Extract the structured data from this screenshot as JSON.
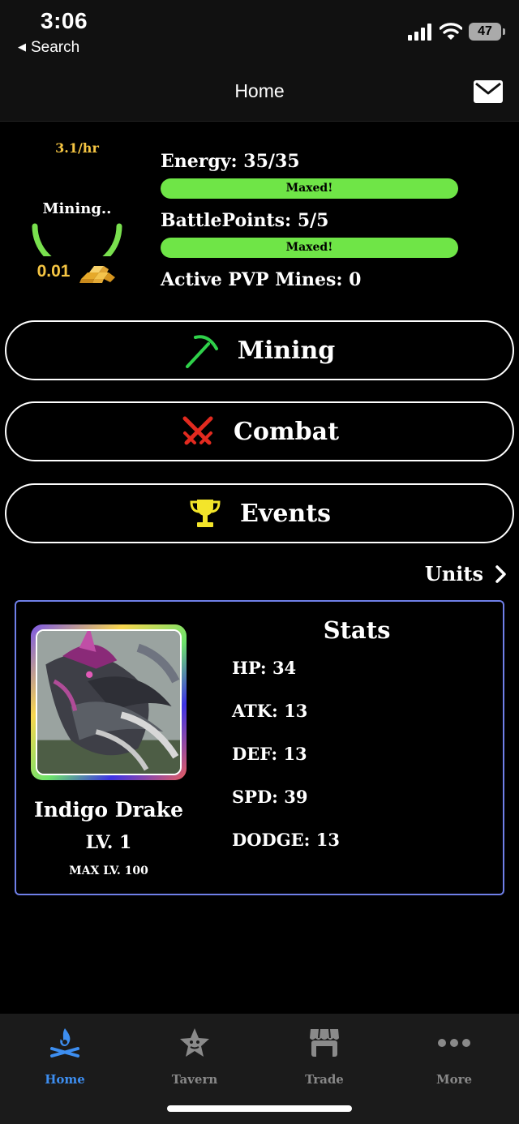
{
  "status_bar": {
    "time": "3:06",
    "back_label": "Search",
    "battery": "47"
  },
  "nav": {
    "title": "Home",
    "mail_icon": "mail-icon"
  },
  "mining": {
    "rate": "3.1/hr",
    "label": "Mining..",
    "gold_amount": "0.01",
    "gold_icon": "gold-bars-icon"
  },
  "stats": {
    "energy": "Energy: 35/35",
    "energy_bar_label": "Maxed!",
    "energy_level": 1.0,
    "battle_points": "BattlePoints: 5/5",
    "battle_bar_label": "Maxed!",
    "battle_level": 1.0,
    "active_pvp": "Active PVP Mines:  0"
  },
  "menu": {
    "mining": {
      "label": "Mining",
      "icon": "pickaxe-icon",
      "color": "#2fd14a"
    },
    "combat": {
      "label": "Combat",
      "icon": "crossed-swords-icon",
      "color": "#e22a1f"
    },
    "events": {
      "label": "Events",
      "icon": "trophy-icon",
      "color": "#f3e52a"
    }
  },
  "units_link": "Units",
  "unit": {
    "name": "Indigo Drake",
    "level": "LV. 1",
    "max_level": "MAX LV. 100",
    "stats_title": "Stats",
    "stats": [
      "HP: 34",
      "ATK: 13",
      "DEF: 13",
      "SPD: 39",
      "DODGE: 13"
    ]
  },
  "tabs": [
    {
      "label": "Home",
      "icon": "campfire-icon",
      "active": true
    },
    {
      "label": "Tavern",
      "icon": "star-badge-icon",
      "active": false
    },
    {
      "label": "Trade",
      "icon": "shop-icon",
      "active": false
    },
    {
      "label": "More",
      "icon": "more-dots-icon",
      "active": false
    }
  ],
  "colors": {
    "accent": "#3d8ef0",
    "bar": "#6fe547",
    "gold": "#f5c543",
    "card_border": "#6f7fe8"
  }
}
